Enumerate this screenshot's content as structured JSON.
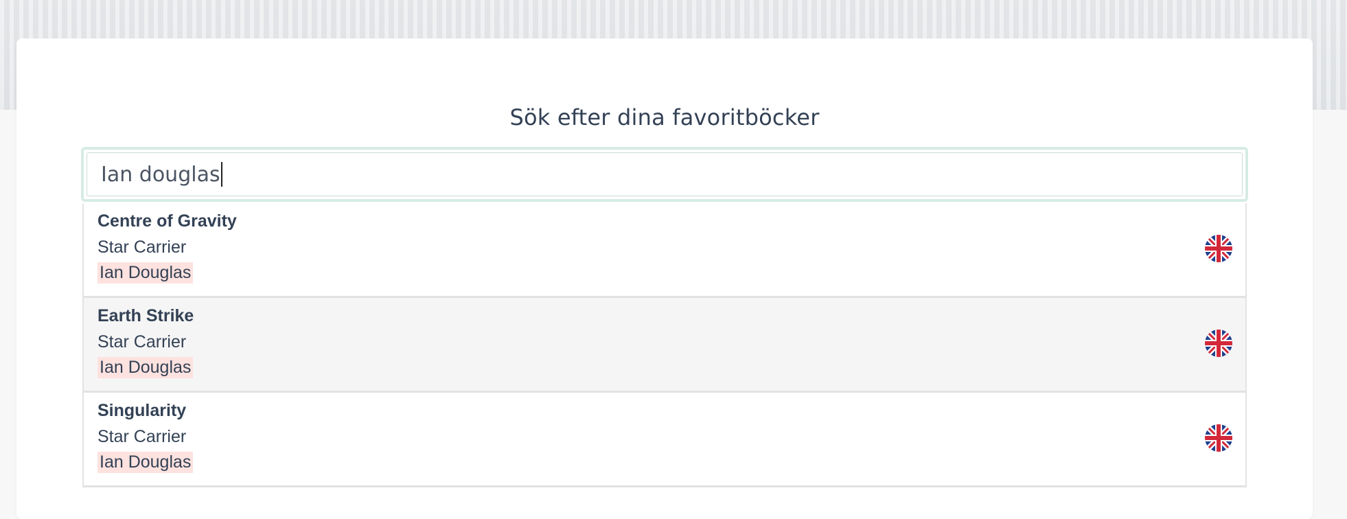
{
  "page": {
    "title": "Sök efter dina favoritböcker"
  },
  "search": {
    "value": "Ian douglas"
  },
  "results": [
    {
      "title": "Centre of Gravity",
      "series": "Star Carrier",
      "author": "Ian Douglas",
      "language_icon": "uk-flag-icon"
    },
    {
      "title": "Earth Strike",
      "series": "Star Carrier",
      "author": "Ian Douglas",
      "language_icon": "uk-flag-icon"
    },
    {
      "title": "Singularity",
      "series": "Star Carrier",
      "author": "Ian Douglas",
      "language_icon": "uk-flag-icon"
    }
  ],
  "colors": {
    "highlight": "#fde2df",
    "focus_ring": "#d6ece4",
    "text": "#334155",
    "alt_row": "#f5f5f5"
  }
}
